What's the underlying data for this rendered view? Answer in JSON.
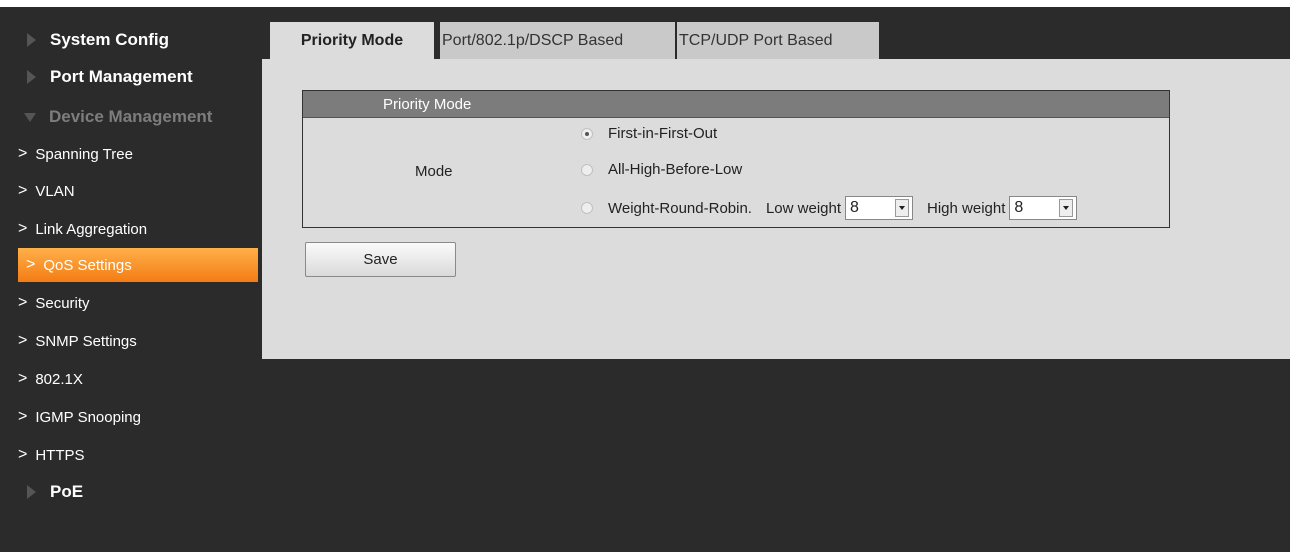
{
  "sidebar": {
    "system_config": "System Config",
    "port_management": "Port Management",
    "device_management": "Device Management",
    "items": [
      {
        "label": "Spanning Tree"
      },
      {
        "label": "VLAN"
      },
      {
        "label": "Link Aggregation"
      },
      {
        "label": "QoS Settings"
      },
      {
        "label": "Security"
      },
      {
        "label": "SNMP Settings"
      },
      {
        "label": "802.1X"
      },
      {
        "label": "IGMP Snooping"
      },
      {
        "label": "HTTPS"
      }
    ],
    "poe": "PoE",
    "active_item": "QoS Settings"
  },
  "tabs": [
    {
      "label": "Priority Mode"
    },
    {
      "label": "Port/802.1p/DSCP Based"
    },
    {
      "label": "TCP/UDP Port Based"
    }
  ],
  "panel": {
    "title": "Priority Mode",
    "mode_label": "Mode",
    "options": [
      {
        "label": "First-in-First-Out",
        "selected": true
      },
      {
        "label": "All-High-Before-Low",
        "selected": false
      },
      {
        "label": "Weight-Round-Robin.",
        "selected": false
      }
    ],
    "low_weight_label": "Low weight",
    "low_weight_value": "8",
    "high_weight_label": "High weight",
    "high_weight_value": "8"
  },
  "save_label": "Save",
  "colors": {
    "background": "#2b2b2b",
    "panel": "#dcdcdc",
    "panel_header": "#7c7c7c",
    "active_item_top": "#ffb04a",
    "active_item_bottom": "#f47c13"
  }
}
